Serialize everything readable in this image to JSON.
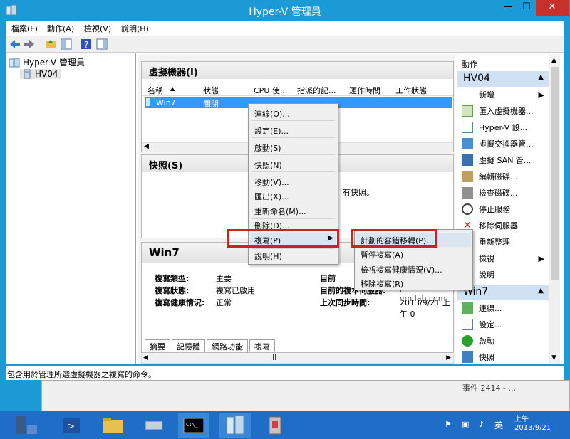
{
  "window": {
    "title": "Hyper-V 管理員",
    "min": "—",
    "max": "☐",
    "close": "✕"
  },
  "menu": [
    "檔案(F)",
    "動作(A)",
    "檢視(V)",
    "說明(H)"
  ],
  "tree": {
    "root": "Hyper-V 管理員",
    "host": "HV04"
  },
  "vm_panel": {
    "title": "虛擬機器(I)",
    "columns": [
      "名稱",
      "狀態",
      "CPU 使...",
      "指派的記...",
      "運作時間",
      "工作狀態"
    ],
    "row": {
      "name": "Win7",
      "state": "關閉"
    }
  },
  "snap_panel": {
    "title": "快照(S)",
    "empty_text": "有快照。"
  },
  "detail_panel": {
    "title": "Win7",
    "labels": [
      "複寫類型:",
      "複寫狀態:",
      "複寫健康情況:"
    ],
    "values": [
      "主要",
      "複寫已啟用",
      "正常"
    ],
    "right_labels": [
      "目前",
      "目前的複本伺服器:",
      "上次同步時間:"
    ],
    "right_values": [
      "",
      "ir-vm.lab.com",
      "2013/9/21 上午 0"
    ],
    "tabs": [
      "摘要",
      "記憶體",
      "網路功能",
      "複寫"
    ]
  },
  "context_menu": [
    "連線(O)...",
    "設定(E)...",
    "啟動(S)",
    "快照(N)",
    "移動(V)...",
    "匯出(X)...",
    "重新命名(M)...",
    "刪除(D)...",
    "複寫(P)",
    "說明(H)"
  ],
  "submenu": [
    "計劃的容錯移轉(P)...",
    "暫停複寫(A)",
    "檢視複寫健康情況(V)...",
    "移除複寫(R)"
  ],
  "actions": {
    "header": "動作",
    "host_header": "HV04",
    "host_items": [
      "新增",
      "匯入虛擬機器...",
      "Hyper-V 設...",
      "虛擬交換器管...",
      "虛擬 SAN 管...",
      "編輯磁碟...",
      "檢查磁碟...",
      "停止服務",
      "移除伺服器",
      "重新整理",
      "檢視",
      "說明"
    ],
    "vm_header": "Win7",
    "vm_items": [
      "連線...",
      "設定...",
      "啟動",
      "快照"
    ]
  },
  "status_text": "包含用於管理所選虛擬機器之複寫的命令。",
  "bgwin_text": "事件 2414 - ...",
  "tray": {
    "ime": "英",
    "time": "上午",
    "date": "2013/9/21"
  }
}
